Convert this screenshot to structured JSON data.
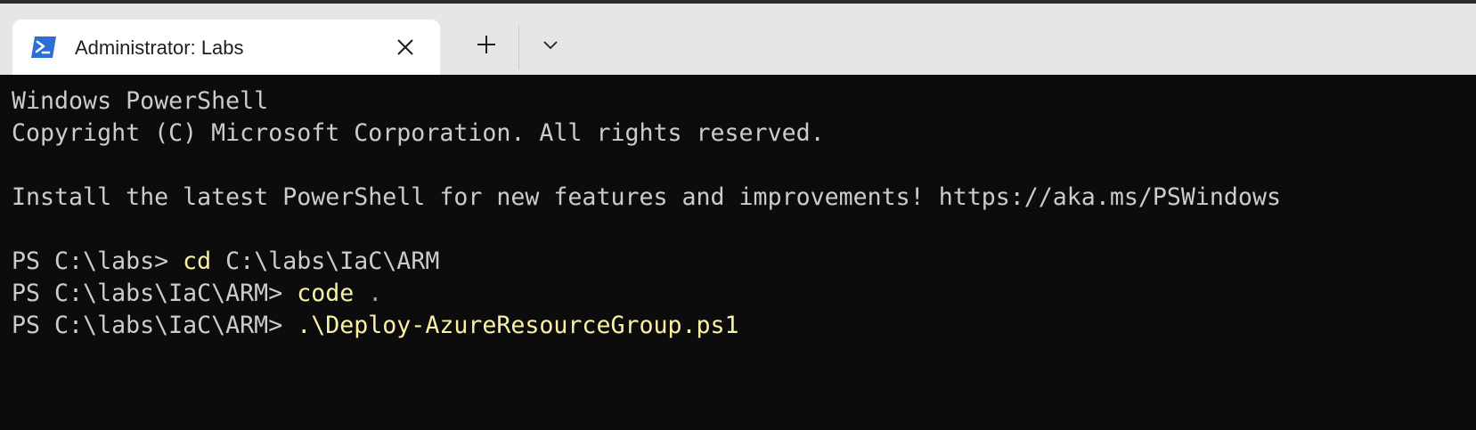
{
  "tab": {
    "title": "Administrator: Labs",
    "icon": "powershell-icon",
    "close_icon": "close-icon"
  },
  "toolbar": {
    "new_tab_icon": "plus-icon",
    "dropdown_icon": "chevron-down-icon"
  },
  "colors": {
    "terminal_bg": "#0c0c0c",
    "text": "#cccccc",
    "command": "#f9f1a5",
    "titlebar_bg": "#e6e6e6",
    "tab_bg": "#ffffff",
    "ps_icon_blue": "#2b6fd6"
  },
  "terminal": {
    "banner_1": "Windows PowerShell",
    "banner_2": "Copyright (C) Microsoft Corporation. All rights reserved.",
    "install_msg": "Install the latest PowerShell for new features and improvements! https://aka.ms/PSWindows",
    "lines": [
      {
        "prompt": "PS C:\\labs> ",
        "command": "cd",
        "args": " C:\\labs\\IaC\\ARM"
      },
      {
        "prompt": "PS C:\\labs\\IaC\\ARM> ",
        "command": "code",
        "args": " ."
      },
      {
        "prompt": "PS C:\\labs\\IaC\\ARM> ",
        "command": ".\\Deploy-AzureResourceGroup.ps1",
        "args": ""
      }
    ]
  }
}
